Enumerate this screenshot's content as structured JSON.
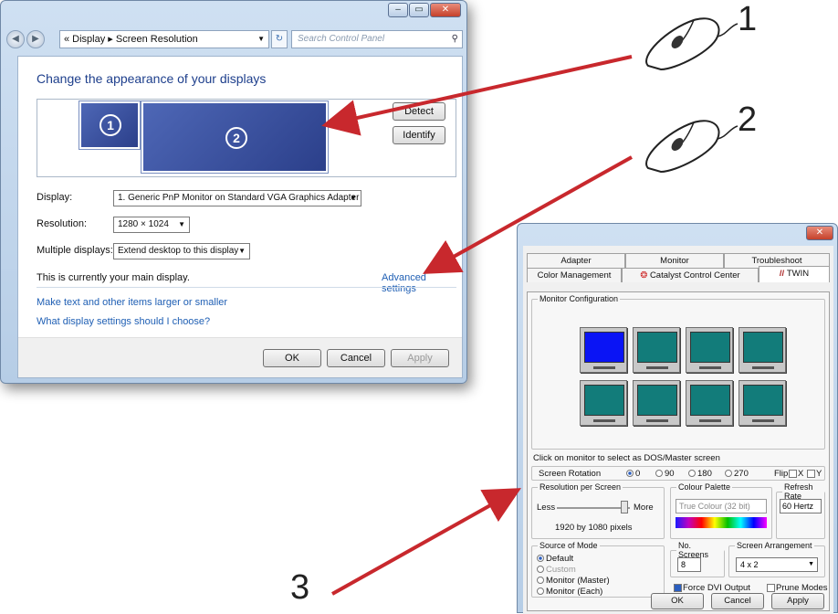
{
  "window1": {
    "address": {
      "crumbs": "« Display ▸ Screen Resolution",
      "search_placeholder": "Search Control Panel"
    },
    "title": "Change the appearance of your displays",
    "monitors": [
      "1",
      "2"
    ],
    "buttons": {
      "detect": "Detect",
      "identify": "Identify",
      "ok": "OK",
      "cancel": "Cancel",
      "apply": "Apply"
    },
    "fields": {
      "display_label": "Display:",
      "display_value": "1. Generic PnP Monitor on Standard VGA Graphics Adapter",
      "resolution_label": "Resolution:",
      "resolution_value": "1280 × 1024",
      "multiple_label": "Multiple displays:",
      "multiple_value": "Extend desktop to this display"
    },
    "main_display_text": "This is currently your main display.",
    "advanced_link": "Advanced settings",
    "links": [
      "Make text and other items larger or smaller",
      "What display settings should I choose?"
    ]
  },
  "window2": {
    "tabs_row1": [
      "Adapter",
      "Monitor",
      "Troubleshoot"
    ],
    "tabs_row2": [
      "Color Management",
      "Catalyst Control Center",
      "TWIN"
    ],
    "monitor_config_legend": "Monitor Configuration",
    "monitor_colors": [
      "#0a14f5",
      "#127c7a",
      "#127c7a",
      "#127c7a",
      "#127c7a",
      "#127c7a",
      "#127c7a",
      "#127c7a"
    ],
    "dos_hint": "Click on monitor to select as DOS/Master screen",
    "rotation": {
      "label": "Screen Rotation",
      "options": [
        "0",
        "90",
        "180",
        "270"
      ],
      "selected": "0",
      "flip_label": "Flip",
      "x_label": "X",
      "y_label": "Y"
    },
    "resolution": {
      "legend": "Resolution per Screen",
      "less": "Less",
      "more": "More",
      "value": "1920 by 1080 pixels"
    },
    "colour": {
      "legend": "Colour Palette",
      "value": "True Colour (32 bit)"
    },
    "refresh": {
      "legend": "Refresh Rate",
      "value": "60 Hertz"
    },
    "source": {
      "legend": "Source of Mode",
      "options": [
        "Default",
        "Custom",
        "Monitor (Master)",
        "Monitor (Each)"
      ],
      "selected": "Default"
    },
    "screens": {
      "legend": "No. Screens",
      "value": "8"
    },
    "arrangement": {
      "legend": "Screen Arrangement",
      "value": "4 x 2"
    },
    "force_dvi": "Force DVI Output",
    "prune": "Prune Modes",
    "buttons": {
      "ok": "OK",
      "cancel": "Cancel",
      "apply": "Apply"
    }
  },
  "callouts": [
    "1",
    "2",
    "3"
  ],
  "colors": {
    "arrow": "#c8282d",
    "link": "#1f5fb4",
    "title": "#1e3f8c"
  }
}
